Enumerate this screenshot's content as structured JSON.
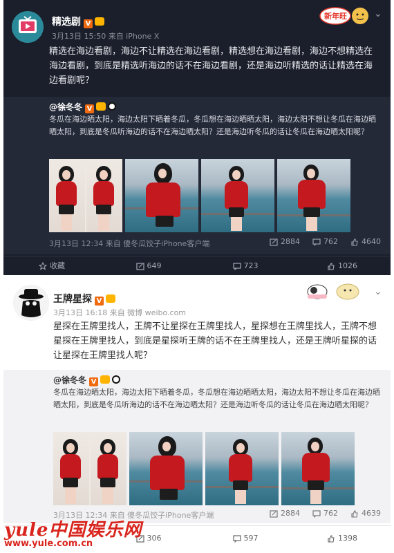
{
  "colors": {
    "dark_bg": "#1b1f2b",
    "dark_repost_bg": "#242938",
    "verified_orange": "#f06a0f",
    "brand_red": "#d9251d",
    "dress_red": "#c3191f"
  },
  "post1": {
    "author": "精选剧",
    "meta": "3月13日 15:50 来自 iPhone X",
    "text": "精选在海边看剧，海边不让精选在海边看剧，精选想在海边看剧，海边不想精选在海边看剧，到底是精选听海边的话不在海边看剧，还是海边听精选的话让精选在海边看剧呢？",
    "sticker_text": "新年旺",
    "repost": {
      "author": "@徐冬冬",
      "text": "冬瓜在海边晒太阳，海边太阳下晒着冬瓜，冬瓜想在海边晒晒太阳，海边太阳不想让冬瓜在海边晒晒太阳，到底是冬瓜听海边的话不在海边晒太阳？还是海边听冬瓜的话让冬瓜在海边晒太阳呢？",
      "meta": "3月13日 12:34 来自 傻冬瓜饺子iPhone客户端",
      "stats": {
        "forward": "2884",
        "comment": "762",
        "like": "4640"
      }
    },
    "actions": {
      "favorite": "收藏",
      "forward": "649",
      "comment": "723",
      "like": "1026"
    }
  },
  "post2": {
    "author": "王牌星探",
    "meta": "3月13日 16:18 来自 微博 weibo.com",
    "text": "星探在王牌里找人，王牌不让星探在王牌里找人，星探想在王牌里找人，王牌不想星探在王牌里找人，到底是星探听王牌的话不在王牌里找人，还是王牌听星探的话让星探在王牌里找人呢？",
    "repost": {
      "author": "@徐冬冬",
      "text": "冬瓜在海边晒太阳，海边太阳下晒着冬瓜，冬瓜想在海边晒晒太阳，海边太阳不想让冬瓜在海边晒晒太阳，到底是冬瓜听海边的话不在海边晒太阳？还是海边听冬瓜的话让冬瓜在海边晒太阳呢？",
      "meta": "3月13日 12:34 来自 傻冬瓜饺子iPhone客户端",
      "stats": {
        "forward": "2884",
        "comment": "762",
        "like": "4639"
      }
    },
    "actions": {
      "forward": "306",
      "comment": "597",
      "like": "1398"
    }
  },
  "watermark": {
    "top": "yule中国娱乐网",
    "bottom": "www.yule.com.cn"
  },
  "icons": {
    "chevron": "chevron-down-icon",
    "forward": "forward-icon",
    "comment": "comment-icon",
    "like": "like-icon",
    "favorite": "star-icon"
  }
}
